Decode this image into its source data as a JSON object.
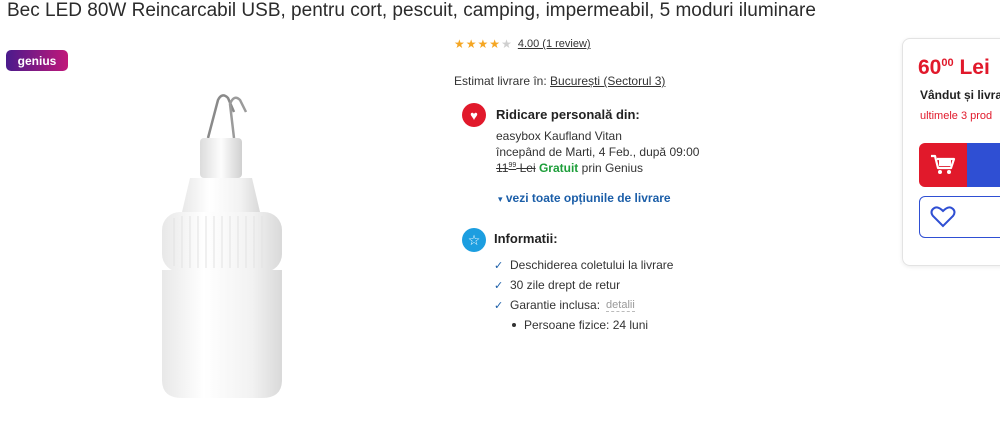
{
  "product": {
    "title": "Bec LED 80W Reincarcabil USB, pentru cort, pescuit, camping, impermeabil, 5 moduri iluminare",
    "badge": "genius",
    "rating_value": 4.0,
    "rating_text": "4.00 (1 review)"
  },
  "delivery": {
    "estimate_label": "Estimat livrare în:",
    "location": "București (Sectorul 3)",
    "pickup": {
      "title": "Ridicare personală din:",
      "place": "easybox Kaufland Vitan",
      "date": "începând de Marti, 4 Feb., după 09:00",
      "old_price_main": "11",
      "old_price_cents": "99",
      "old_price_currency": "Lei",
      "free_label": "Gratuit",
      "via": "prin Genius"
    },
    "all_options": "vezi toate opțiunile de livrare"
  },
  "info": {
    "title": "Informatii:",
    "items": [
      "Deschiderea coletului la livrare",
      "30 zile drept de retur",
      "Garantie inclusa:"
    ],
    "details_link": "detalii",
    "sub_items": [
      "Persoane fizice: 24 luni"
    ]
  },
  "sidebar": {
    "price_main": "60",
    "price_cents": "00",
    "currency": "Lei",
    "seller": "Vândut și livra",
    "stock": "ultimele 3 prod"
  },
  "colors": {
    "accent_red": "#e1192b",
    "accent_blue": "#2f4fd3",
    "link_blue": "#1b5ea8",
    "free_green": "#1d9e3a"
  },
  "icons": [
    "heart-icon",
    "star-icon",
    "cart-icon",
    "check-icon",
    "chevron-down-icon"
  ]
}
